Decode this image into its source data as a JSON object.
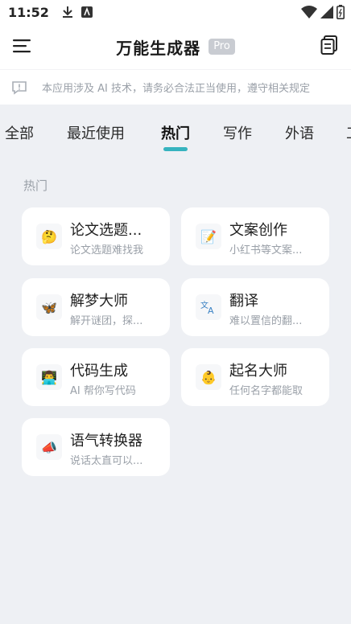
{
  "status_bar": {
    "time": "11:52"
  },
  "header": {
    "title": "万能生成器",
    "badge": "Pro"
  },
  "notice": {
    "text": "本应用涉及 AI 技术，请务必合法正当使用，遵守相关规定"
  },
  "tabs": [
    {
      "label": "全部"
    },
    {
      "label": "最近使用"
    },
    {
      "label": "热门",
      "active": true
    },
    {
      "label": "写作"
    },
    {
      "label": "外语"
    },
    {
      "label": "工"
    }
  ],
  "section": {
    "label": "热门",
    "cards": [
      {
        "title": "论文选题...",
        "desc": "论文选题难找我",
        "icon": "thinking-face-emoji"
      },
      {
        "title": "文案创作",
        "desc": "小红书等文案...",
        "icon": "memo-emoji"
      },
      {
        "title": "解梦大师",
        "desc": "解开谜团，探...",
        "icon": "butterfly-emoji"
      },
      {
        "title": "翻译",
        "desc": "难以置信的翻...",
        "icon": "translate-icon"
      },
      {
        "title": "代码生成",
        "desc": "AI 帮你写代码",
        "icon": "technologist-emoji"
      },
      {
        "title": "起名大师",
        "desc": "任何名字都能取",
        "icon": "baby-emoji"
      },
      {
        "title": "语气转换器",
        "desc": "说话太直可以...",
        "icon": "megaphone-emoji"
      }
    ]
  },
  "colors": {
    "accent": "#36b3bf",
    "background": "#eef0f4"
  }
}
